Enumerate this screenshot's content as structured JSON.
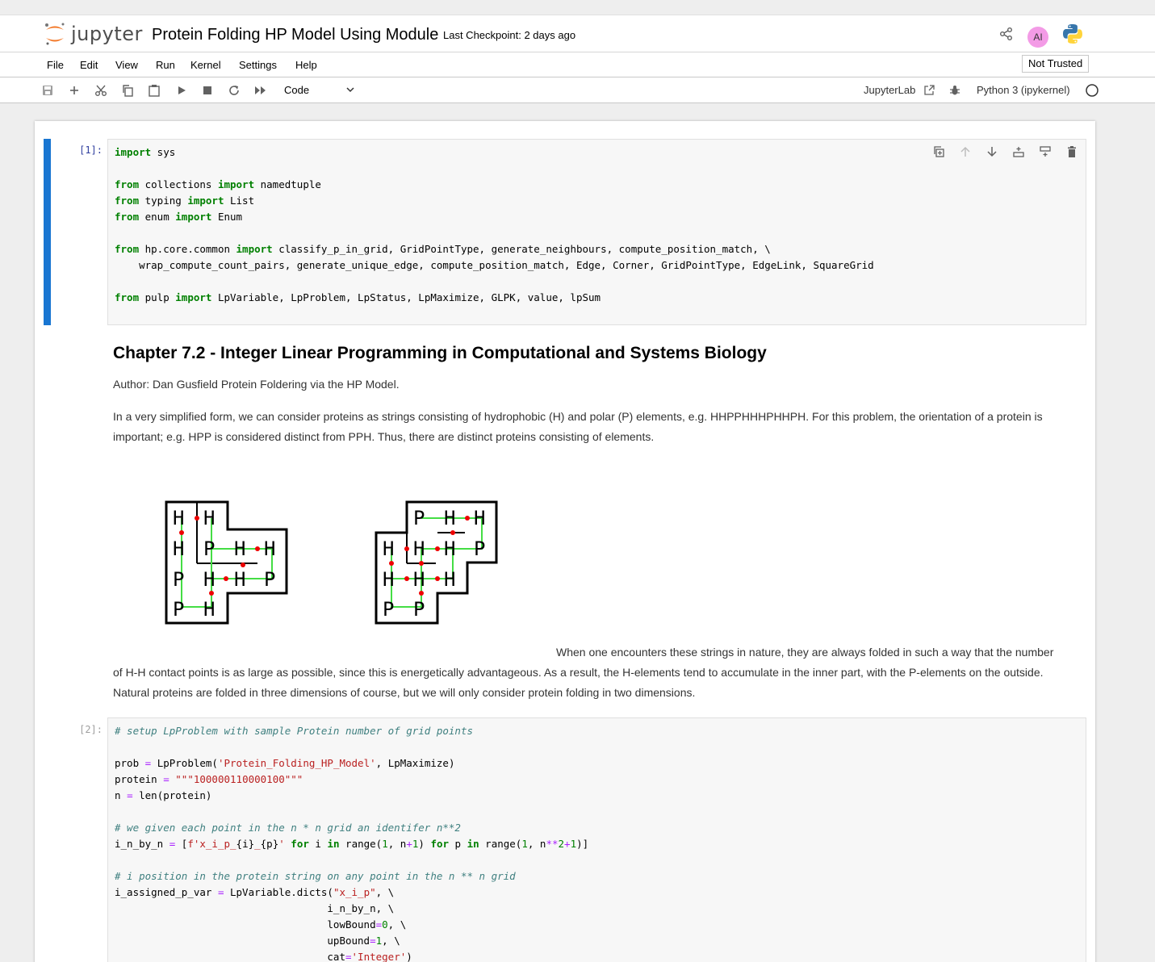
{
  "header": {
    "logo_text": "jupyter",
    "notebook_title": "Protein Folding HP Model Using Module",
    "checkpoint": "Last Checkpoint: 2 days ago",
    "avatar_initials": "AI"
  },
  "menu": {
    "items": [
      "File",
      "Edit",
      "View",
      "Run",
      "Kernel",
      "Settings",
      "Help"
    ],
    "trust": "Not Trusted"
  },
  "toolbar": {
    "cell_type": "Code",
    "jupyterlab_label": "JupyterLab",
    "kernel": "Python 3 (ipykernel)"
  },
  "cells": {
    "cell1_prompt": "[1]:",
    "cell2_prompt": "[2]:",
    "markdown": {
      "title": "Chapter 7.2 - Integer Linear Programming in Computational and Systems Biology",
      "author": "Author: Dan Gusfield Protein Foldering via the HP Model.",
      "para1": "In a very simplified form, we can consider proteins as strings consisting of hydrophobic (H) and polar (P) elements, e.g. HHPPHHHPHHPH. For this problem, the orientation of a protein is important; e.g. HPP is considered distinct from PPH. Thus, there are distinct proteins consisting of elements.",
      "para2": "When one encounters these strings in nature, they are always folded in such a way that the number of H-H contact points is as large as possible, since this is energetically advantageous. As a result, the H-elements tend to accumulate in the inner part, with the P-elements on the outside. Natural proteins are folded in three dimensions of course, but we will only consider protein folding in two dimensions."
    }
  },
  "colors": {
    "accent": "#1976d2",
    "keyword": "#008000",
    "comment": "#408080",
    "string": "#ba2121"
  }
}
